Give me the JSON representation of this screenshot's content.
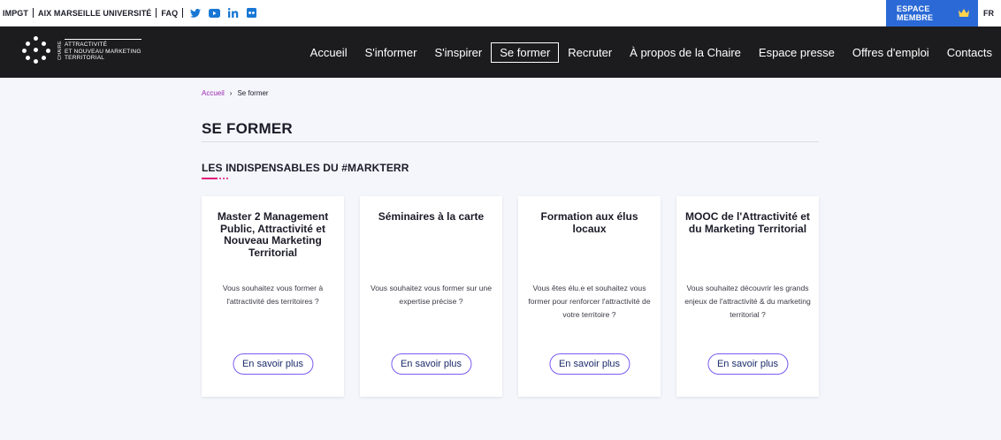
{
  "utilbar": {
    "links": [
      "IMPGT",
      "AIX MARSEILLE UNIVERSITÉ",
      "FAQ"
    ],
    "social": [
      "twitter-icon",
      "youtube-icon",
      "linkedin-icon",
      "flickr-icon"
    ],
    "member_label": "ESPACE MEMBRE",
    "lang": "FR"
  },
  "logo": {
    "vertical": "CHAIRE",
    "lines": [
      "ATTRACTIVITÉ",
      "ET NOUVEAU MARKETING",
      "TERRITORIAL"
    ]
  },
  "nav": {
    "items": [
      "Accueil",
      "S'informer",
      "S'inspirer",
      "Se former",
      "Recruter",
      "À propos de la Chaire",
      "Espace presse",
      "Offres d'emploi",
      "Contacts"
    ],
    "active": "Se former"
  },
  "breadcrumb": {
    "home": "Accueil",
    "sep": "›",
    "current": "Se former"
  },
  "page": {
    "title": "SE FORMER",
    "section": "LES INDISPENSABLES DU #MARKTERR"
  },
  "cards": [
    {
      "title": "Master 2 Management Public, Attractivité et Nouveau Marketing Territorial",
      "desc": "Vous souhaitez vous former à l'attractivité des territoires ?",
      "button": "En savoir plus"
    },
    {
      "title": "Séminaires à la carte",
      "desc": "Vous souhaitez vous former sur une expertise précise ?",
      "button": "En savoir plus"
    },
    {
      "title": "Formation aux élus locaux",
      "desc": "Vous êtes élu.e et souhaitez vous former pour renforcer l'attractivité de votre territoire ?",
      "button": "En savoir plus"
    },
    {
      "title": "MOOC de l'Attractivité et du Marketing Territorial",
      "desc": "Vous souhaitez découvrir les grands enjeux de l'attractivité & du marketing territorial ?",
      "button": "En savoir plus"
    }
  ],
  "colors": {
    "nav_bg": "#1c1c1e",
    "member_bg": "#2b6ad6",
    "accent": "#e2147b",
    "button_border": "#7b5cf0",
    "link": "#9b27af"
  }
}
